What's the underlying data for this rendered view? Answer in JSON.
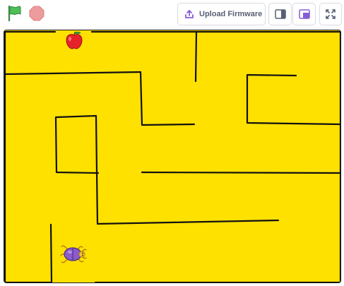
{
  "toolbar": {
    "green_flag": {
      "icon": "green-flag-icon",
      "color": "#4cbf56"
    },
    "stop": {
      "icon": "stop-sign-icon",
      "color": "#ec9c9c"
    },
    "upload_firmware_label": "Upload Firmware",
    "upload_icon": "upload-icon",
    "small_stage_icon": "small-stage-icon",
    "large_stage_icon": "large-stage-icon",
    "fullscreen_icon": "fullscreen-icon",
    "accent_color": "#855cd6"
  },
  "stage": {
    "background_color": "#ffe100",
    "maze_wall_color": "#111111",
    "sprites": {
      "goal": "apple-sprite",
      "player": "beetle-sprite"
    }
  }
}
